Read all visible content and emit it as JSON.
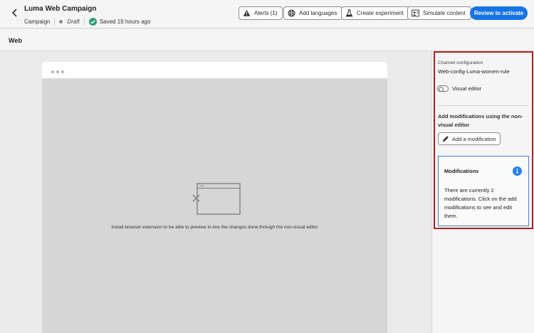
{
  "header": {
    "title": "Luma Web Campaign",
    "type": "Campaign",
    "status": "Draft",
    "saved": "Saved 19 hours ago",
    "buttons": {
      "alerts": "Alerts (1)",
      "languages": "Add languages",
      "experiment": "Create experiment",
      "simulate": "Simulate content",
      "review": "Review to activate"
    }
  },
  "section": {
    "title": "Web"
  },
  "preview": {
    "message": "Install browser extension to be able to preview in-line the changes done through the non-visual editor"
  },
  "panel": {
    "channel_caption": "Channel configuration",
    "channel_value": "Web-config-Luma-women-rule",
    "visual_editor_label": "Visual editor",
    "visual_editor_enabled": false,
    "modifications_heading": "Add modifications using the non-visual editor",
    "add_button": "Add a modification",
    "modifications_title": "Modifications",
    "modifications_text": "There are currently 2 modifications. Click on the add modifications to see and edit them."
  },
  "colors": {
    "accent": "#1473e6",
    "highlight": "#b51e1e",
    "success": "#2d9d78",
    "info": "#2680eb"
  },
  "icons": [
    "chevron-left-icon",
    "success-check-icon",
    "alert-triangle-icon",
    "globe-icon",
    "beaker-icon",
    "simulate-icon",
    "pencil-icon",
    "info-icon",
    "broken-page-icon"
  ]
}
